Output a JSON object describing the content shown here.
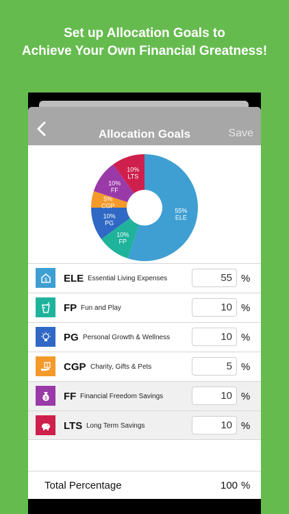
{
  "promo": {
    "line1": "Set up Allocation Goals to",
    "line2": "Achieve Your Own Financial Greatness!"
  },
  "navbar": {
    "back_icon": "chevron-left-icon",
    "title": "Allocation Goals",
    "save_label": "Save"
  },
  "chart_data": {
    "type": "pie",
    "style": "donut",
    "slices": [
      {
        "code": "ELE",
        "value": 55,
        "label_pct": "55%",
        "color": "#3f9fd3"
      },
      {
        "code": "FP",
        "value": 10,
        "label_pct": "10%",
        "color": "#1fb39b"
      },
      {
        "code": "PG",
        "value": 10,
        "label_pct": "10%",
        "color": "#2f68c5"
      },
      {
        "code": "CGP",
        "value": 5,
        "label_pct": "5%",
        "color": "#f39a2a"
      },
      {
        "code": "FF",
        "value": 10,
        "label_pct": "10%",
        "color": "#9a3aa8"
      },
      {
        "code": "LTS",
        "value": 10,
        "label_pct": "10%",
        "color": "#cf1f4c"
      }
    ]
  },
  "categories": [
    {
      "code": "ELE",
      "desc": "Essential Living Expenses",
      "value": "55",
      "pct": "%",
      "color": "#3f9fd3",
      "icon": "house-dollar-icon",
      "shaded": false
    },
    {
      "code": "FP",
      "desc": "Fun and Play",
      "value": "10",
      "pct": "%",
      "color": "#1fb39b",
      "icon": "drink-icon",
      "shaded": false
    },
    {
      "code": "PG",
      "desc": "Personal Growth & Wellness",
      "value": "10",
      "pct": "%",
      "color": "#2f68c5",
      "icon": "lightbulb-icon",
      "shaded": false
    },
    {
      "code": "CGP",
      "desc": "Charity, Gifts & Pets",
      "value": "5",
      "pct": "%",
      "color": "#f39a2a",
      "icon": "gift-hand-icon",
      "shaded": false
    },
    {
      "code": "FF",
      "desc": "Financial Freedom Savings",
      "value": "10",
      "pct": "%",
      "color": "#9a3aa8",
      "icon": "money-bag-icon",
      "shaded": true
    },
    {
      "code": "LTS",
      "desc": "Long Term Savings",
      "value": "10",
      "pct": "%",
      "color": "#cf1f4c",
      "icon": "piggy-bank-icon",
      "shaded": true
    }
  ],
  "total": {
    "label": "Total Percentage",
    "value": "100",
    "pct": "%"
  }
}
